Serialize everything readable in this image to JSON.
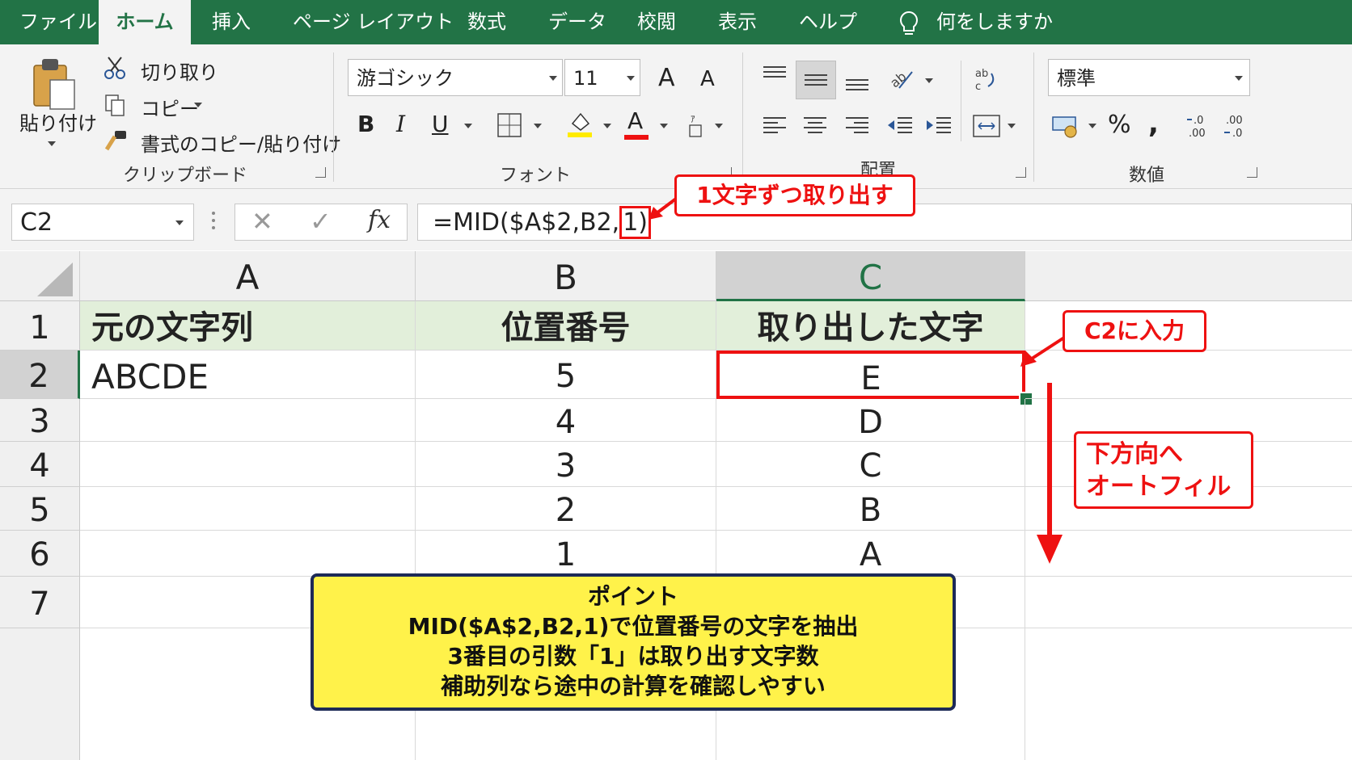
{
  "tabs": [
    "ファイル",
    "ホーム",
    "挿入",
    "ページ レイアウト",
    "数式",
    "データ",
    "校閲",
    "表示",
    "ヘルプ"
  ],
  "tell_me": "何をしますか",
  "clipboard": {
    "paste_label": "貼り付け",
    "cut_label": "切り取り",
    "copy_label": "コピー",
    "format_painter_label": "書式のコピー/貼り付け",
    "group_label": "クリップボード"
  },
  "font": {
    "name": "游ゴシック",
    "size": "11",
    "bold": "B",
    "italic": "I",
    "underline": "U",
    "grow": "A",
    "shrink": "A",
    "color_letter": "A",
    "group_label": "フォント"
  },
  "alignment": {
    "group_label": "配置"
  },
  "number": {
    "format": "標準",
    "percent": "%",
    "comma": ",",
    "group_label": "数値"
  },
  "formula_bar": {
    "name_box": "C2",
    "cancel": "✕",
    "enter": "✓",
    "fx": "fx",
    "formula_prefix": "=MID($A$2,B2,",
    "formula_highlight": "1)"
  },
  "columns": [
    "A",
    "B",
    "C"
  ],
  "rows": [
    "1",
    "2",
    "3",
    "4",
    "5",
    "6",
    "7"
  ],
  "cells": {
    "A1": "元の文字列",
    "B1": "位置番号",
    "C1": "取り出した文字",
    "A2": "ABCDE",
    "B2": "5",
    "C2": "E",
    "B3": "4",
    "C3": "D",
    "B4": "3",
    "C4": "C",
    "B5": "2",
    "C5": "B",
    "B6": "1",
    "C6": "A"
  },
  "annotations": {
    "formula_callout": "1文字ずつ取り出す",
    "c2_callout": "C2に入力",
    "autofill_line1": "下方向へ",
    "autofill_line2": "オートフィル"
  },
  "point_box": {
    "title": "ポイント",
    "lines": [
      "MID($A$2,B2,1)で位置番号の文字を抽出",
      "3番目の引数「1」は取り出す文字数",
      "補助列なら途中の計算を確認しやすい"
    ]
  },
  "colors": {
    "excel_green": "#227346",
    "header_fill": "#e2efda",
    "accent_red": "#e11111",
    "note_yellow": "#fff24a",
    "note_border": "#1d2a57"
  }
}
